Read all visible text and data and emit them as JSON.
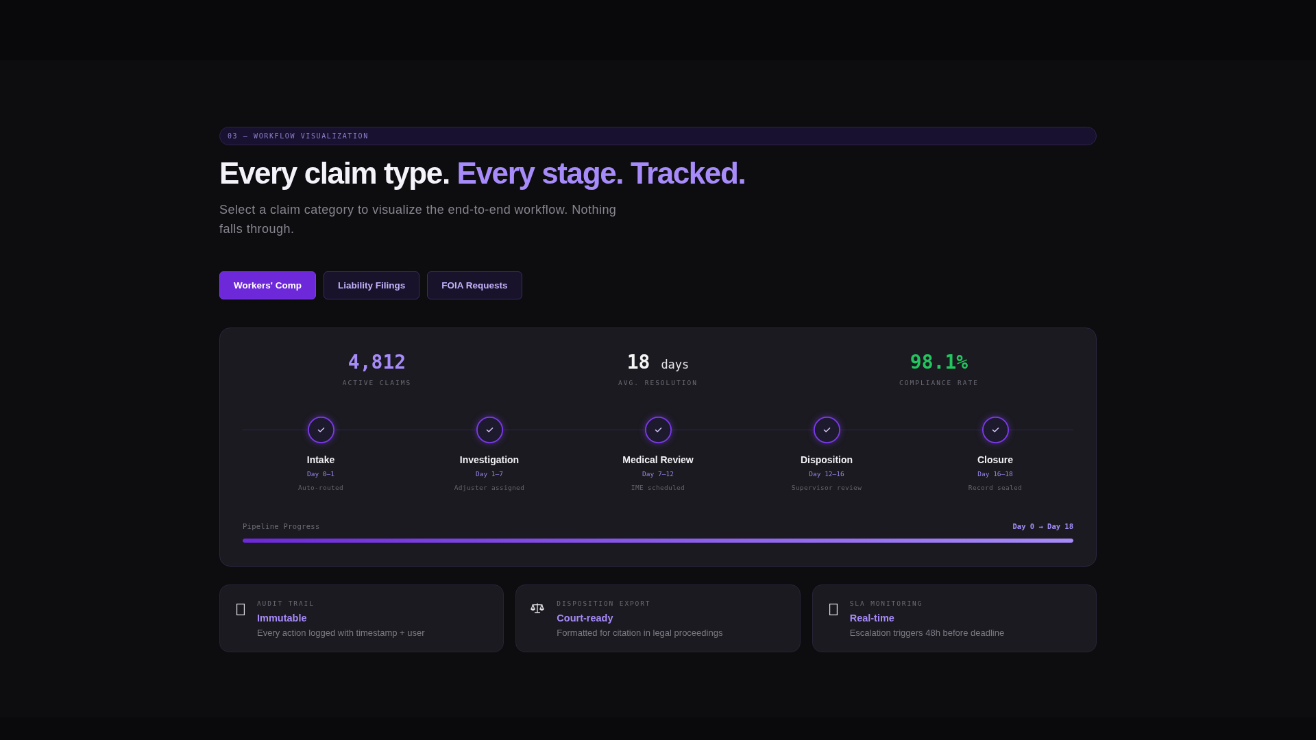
{
  "eyebrow": "03 — WORKFLOW VISUALIZATION",
  "heading": {
    "text": "Every claim type.",
    "accent": "Every stage. Tracked."
  },
  "subtitle": "Select a claim category to visualize the end-to-end workflow. Nothing falls through.",
  "tabs": [
    {
      "label": "Workers' Comp",
      "selected": true
    },
    {
      "label": "Liability Filings",
      "selected": false
    },
    {
      "label": "FOIA Requests",
      "selected": false
    }
  ],
  "stats": [
    {
      "value": "4,812",
      "label": "ACTIVE CLAIMS",
      "color": "#a78bfa"
    },
    {
      "value": "18",
      "unit": "days",
      "label": "AVG. RESOLUTION",
      "color": "#f4f4f5"
    },
    {
      "value": "98.1%",
      "label": "COMPLIANCE RATE",
      "color": "#22c55e"
    }
  ],
  "stages": [
    {
      "name": "Intake",
      "days": "Day 0–1",
      "note": "Auto-routed",
      "done": true
    },
    {
      "name": "Investigation",
      "days": "Day 1–7",
      "note": "Adjuster assigned",
      "done": true
    },
    {
      "name": "Medical Review",
      "days": "Day 7–12",
      "note": "IME scheduled",
      "done": true
    },
    {
      "name": "Disposition",
      "days": "Day 12–16",
      "note": "Supervisor review",
      "done": true
    },
    {
      "name": "Closure",
      "days": "Day 16–18",
      "note": "Record sealed",
      "done": true
    }
  ],
  "progress": {
    "label": "Pipeline Progress",
    "range": "Day 0 → Day 18",
    "level": 1
  },
  "features": [
    {
      "label": "AUDIT TRAIL",
      "title": "Immutable",
      "description": "Every action logged with timestamp + user"
    },
    {
      "label": "DISPOSITION EXPORT",
      "title": "Court-ready",
      "description": "Formatted for citation in legal proceedings"
    },
    {
      "label": "SLA MONITORING",
      "title": "Real-time",
      "description": "Escalation triggers 48h before deadline"
    }
  ]
}
